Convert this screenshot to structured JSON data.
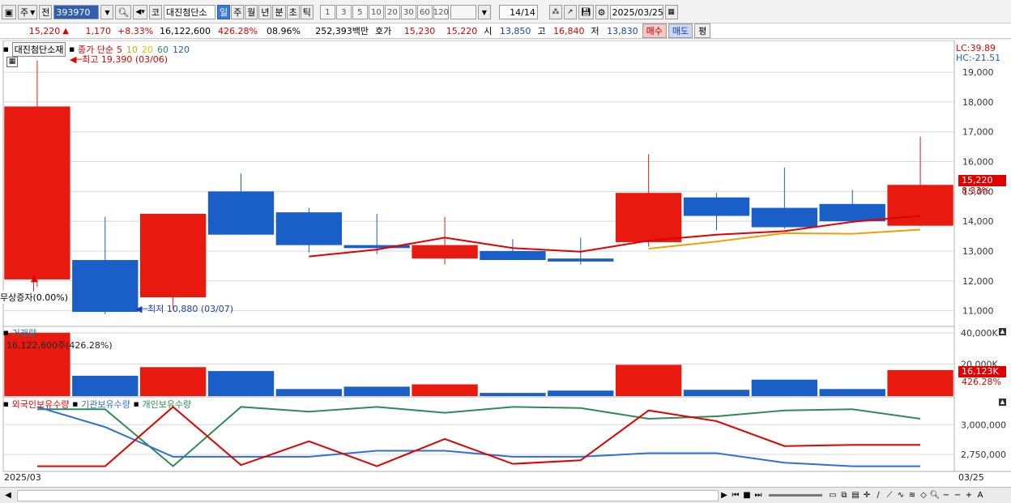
{
  "toolbar": {
    "market_label": "주",
    "prev_label": "전",
    "code": "393970",
    "stock_name": "대진첨단소",
    "stock_type_label": "코",
    "periods": [
      "일",
      "주",
      "월",
      "년",
      "분",
      "초",
      "틱"
    ],
    "active_period": "일",
    "intervals": [
      "1",
      "3",
      "5",
      "10",
      "20",
      "30",
      "60",
      "120"
    ],
    "page": "14/14",
    "date": "2025/03/25"
  },
  "quote": {
    "price": "15,220",
    "change": "1,170",
    "change_pct": "+8.33%",
    "volume": "16,122,600",
    "volume_pct": "426.28%",
    "turnover": "08.96%",
    "amount": "252,393백만",
    "bid_label": "호가",
    "ask": "15,230",
    "bid": "15,220",
    "open_label": "시",
    "open": "13,850",
    "high_label": "고",
    "high": "16,840",
    "low_label": "저",
    "low": "13,830",
    "buy_label": "매수",
    "sell_label": "매도",
    "avg_label": "평"
  },
  "price_panel": {
    "stock_name": "대진첨단소재",
    "legend_prefix": "종가 단순",
    "ma_periods": [
      "5",
      "10",
      "20",
      "60",
      "120"
    ],
    "ma_colors": [
      "#e00000",
      "#f0a000",
      "#e0c000",
      "#2e8b57",
      "#1a5fb4"
    ],
    "high_marker": "최고 19,390 (03/06)",
    "low_marker": "최저 10,880 (03/07)",
    "event_label": "무상증자(0.00%)",
    "lc_label": "LC:39.89",
    "hc_label": "HC:-21.51",
    "current_price": "15,220",
    "current_pct": "8.33%"
  },
  "volume_panel": {
    "title": "거래량",
    "value_label": "16,122,600주(426.28%)",
    "current": "16,123K",
    "current_pct": "426.28%"
  },
  "holdings_panel": {
    "series_labels": [
      "외국인보유수량",
      "기관보유수량",
      "개인보유수량"
    ],
    "series_colors": [
      "#e00000",
      "#2f6fd6",
      "#2e8b57"
    ]
  },
  "x_axis": {
    "start": "2025/03",
    "end": "03/25"
  },
  "chart_data": [
    {
      "type": "candlestick",
      "panel": "price",
      "ylim": [
        10500,
        19900
      ],
      "yticks": [
        11000,
        12000,
        13000,
        14000,
        15000,
        16000,
        17000,
        18000,
        19000
      ],
      "candles": [
        {
          "o": 12050,
          "h": 19390,
          "l": 11800,
          "c": 17850
        },
        {
          "o": 12700,
          "h": 14150,
          "l": 10880,
          "c": 10960
        },
        {
          "o": 11450,
          "h": 14250,
          "l": 11050,
          "c": 14250
        },
        {
          "o": 15000,
          "h": 15600,
          "l": 13550,
          "c": 13550
        },
        {
          "o": 14300,
          "h": 14450,
          "l": 12950,
          "c": 13200
        },
        {
          "o": 13200,
          "h": 14250,
          "l": 12900,
          "c": 13100
        },
        {
          "o": 12750,
          "h": 14150,
          "l": 12550,
          "c": 13200
        },
        {
          "o": 13000,
          "h": 13400,
          "l": 12700,
          "c": 12700
        },
        {
          "o": 12750,
          "h": 13450,
          "l": 12550,
          "c": 12650
        },
        {
          "o": 13300,
          "h": 16250,
          "l": 13150,
          "c": 14950
        },
        {
          "o": 14800,
          "h": 14950,
          "l": 13700,
          "c": 14180
        },
        {
          "o": 14450,
          "h": 15800,
          "l": 13750,
          "c": 13800
        },
        {
          "o": 14580,
          "h": 15050,
          "l": 13950,
          "c": 14000
        },
        {
          "o": 13850,
          "h": 16840,
          "l": 13830,
          "c": 15220
        }
      ],
      "ma5": [
        null,
        null,
        null,
        null,
        12820,
        13050,
        13450,
        13100,
        12980,
        13350,
        13550,
        13670,
        13980,
        14180
      ],
      "ma10": [
        null,
        null,
        null,
        null,
        null,
        null,
        null,
        null,
        null,
        13080,
        13320,
        13600,
        13580,
        13720
      ]
    },
    {
      "type": "bar",
      "panel": "volume",
      "ylim": [
        0,
        42000
      ],
      "yticks": [
        20000,
        40000
      ],
      "unit": "K",
      "values": [
        40000,
        12500,
        18000,
        15500,
        4000,
        5500,
        7000,
        1500,
        3000,
        19500,
        3500,
        10000,
        4000,
        16123
      ]
    },
    {
      "type": "line",
      "panel": "holdings",
      "ylim": [
        2620000,
        3200000
      ],
      "yticks": [
        2750000,
        3000000
      ],
      "series": [
        {
          "name": "외국인보유수량",
          "values": [
            2650000,
            2650000,
            3150000,
            2660000,
            2860000,
            2650000,
            2880000,
            2670000,
            2700000,
            3120000,
            3030000,
            2820000,
            2830000,
            2830000
          ]
        },
        {
          "name": "기관보유수량",
          "values": [
            3150000,
            2980000,
            2730000,
            2730000,
            2730000,
            2780000,
            2780000,
            2730000,
            2730000,
            2760000,
            2760000,
            2680000,
            2650000,
            2650000
          ]
        },
        {
          "name": "개인보유수량",
          "values": [
            3130000,
            3130000,
            2650000,
            3150000,
            3110000,
            3150000,
            3100000,
            3150000,
            3140000,
            3050000,
            3070000,
            3120000,
            3130000,
            3050000
          ]
        }
      ]
    }
  ]
}
